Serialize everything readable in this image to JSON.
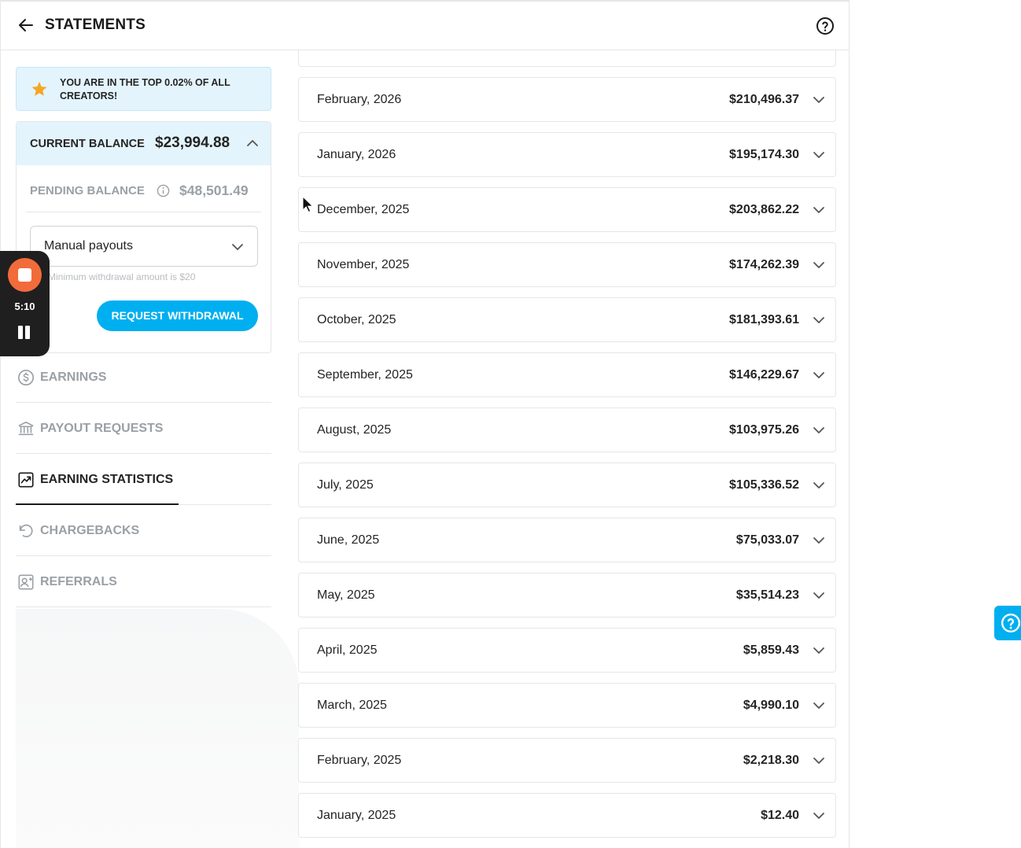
{
  "header": {
    "title": "STATEMENTS",
    "back_icon": "arrow-left-icon",
    "help_icon": "question-circle-icon"
  },
  "banner": {
    "icon": "star-icon",
    "text": "YOU ARE IN THE TOP 0.02% OF ALL CREATORS!"
  },
  "balance": {
    "current_label": "CURRENT BALANCE",
    "current_amount": "$23,994.88",
    "pending_label": "PENDING BALANCE",
    "pending_amount": "$48,501.49",
    "payout_mode": "Manual payouts",
    "min_note": "Minimum withdrawal amount is $20",
    "withdraw_label": "REQUEST WITHDRAWAL"
  },
  "nav": {
    "items": [
      {
        "label": "EARNINGS",
        "icon": "dollar-circle-icon"
      },
      {
        "label": "PAYOUT REQUESTS",
        "icon": "bank-icon"
      },
      {
        "label": "EARNING STATISTICS",
        "icon": "chart-icon",
        "active": true
      },
      {
        "label": "CHARGEBACKS",
        "icon": "undo-icon"
      },
      {
        "label": "REFERRALS",
        "icon": "contact-card-icon"
      }
    ]
  },
  "statements": [
    {
      "month": "February, 2026",
      "amount": "$210,496.37"
    },
    {
      "month": "January, 2026",
      "amount": "$195,174.30"
    },
    {
      "month": "December, 2025",
      "amount": "$203,862.22"
    },
    {
      "month": "November, 2025",
      "amount": "$174,262.39"
    },
    {
      "month": "October, 2025",
      "amount": "$181,393.61"
    },
    {
      "month": "September, 2025",
      "amount": "$146,229.67"
    },
    {
      "month": "August, 2025",
      "amount": "$103,975.26"
    },
    {
      "month": "July, 2025",
      "amount": "$105,336.52"
    },
    {
      "month": "June, 2025",
      "amount": "$75,033.07"
    },
    {
      "month": "May, 2025",
      "amount": "$35,514.23"
    },
    {
      "month": "April, 2025",
      "amount": "$5,859.43"
    },
    {
      "month": "March, 2025",
      "amount": "$4,990.10"
    },
    {
      "month": "February, 2025",
      "amount": "$2,218.30"
    },
    {
      "month": "January, 2025",
      "amount": "$12.40"
    }
  ],
  "recorder": {
    "time": "5:10"
  },
  "colors": {
    "accent": "#00aff0",
    "banner_bg": "#e3f4fd",
    "recorder_stop": "#f26b3a"
  }
}
